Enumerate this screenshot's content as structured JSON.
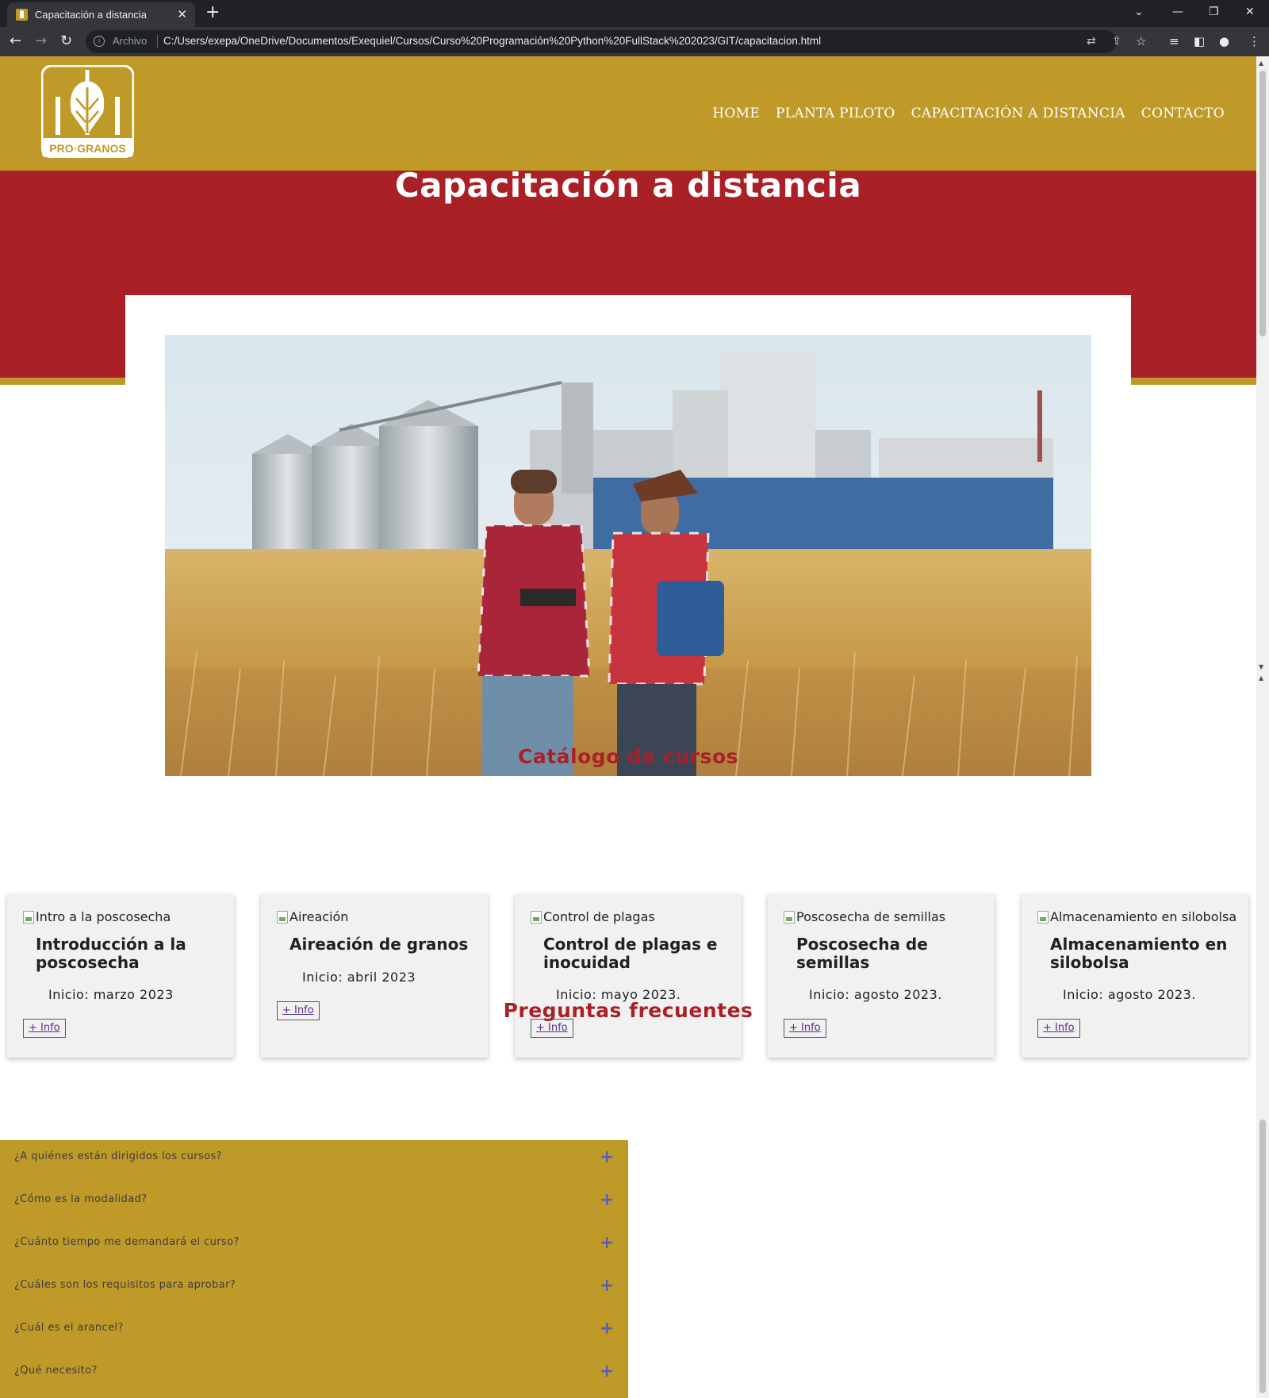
{
  "browser": {
    "tab_title": "Capacitación a distancia",
    "scheme_label": "Archivo",
    "url": "C:/Users/exepa/OneDrive/Documentos/Exequiel/Cursos/Curso%20Programación%20Python%20FullStack%202023/GIT/capacitacion.html"
  },
  "header": {
    "logo_text": "PRO·GRANOS",
    "nav": [
      "HOME",
      "PLANTA PILOTO",
      "CAPACITACIÓN A DISTANCIA",
      "CONTACTO"
    ]
  },
  "hero": {
    "title": "Capacitación a distancia"
  },
  "catalog": {
    "title": "Catálogo de cursos",
    "courses": [
      {
        "img_alt": "Intro a la poscosecha",
        "title": "Introducción a la poscosecha",
        "start": "Inicio: marzo 2023",
        "button": "+ Info"
      },
      {
        "img_alt": "Aireación",
        "title": "Aireación de granos",
        "start": "Inicio: abril 2023",
        "button": "+ Info"
      },
      {
        "img_alt": "Control de plagas",
        "title": "Control de plagas e inocuidad",
        "start": "Inicio: mayo 2023.",
        "button": "+ Info"
      },
      {
        "img_alt": "Poscosecha de semillas",
        "title": "Poscosecha de semillas",
        "start": "Inicio: agosto 2023.",
        "button": "+ Info"
      },
      {
        "img_alt": "Almacenamiento en silobolsa",
        "title": "Almacenamiento en silobolsa",
        "start": "Inicio: agosto 2023.",
        "button": "+ Info"
      }
    ]
  },
  "faq": {
    "title": "Preguntas frecuentes",
    "items": [
      "¿A quiénes están dirigidos los cursos?",
      "¿Cómo es la modalidad?",
      "¿Cuánto tiempo me demandará el curso?",
      "¿Cuáles son los requisitos para aprobar?",
      "¿Cuál es el arancel?",
      "¿Qué necesito?"
    ],
    "expand_symbol": "+"
  },
  "colors": {
    "gold": "#bf9a29",
    "red": "#a92027",
    "card_bg": "#f1f1f1",
    "faq_plus": "#5860b0"
  }
}
